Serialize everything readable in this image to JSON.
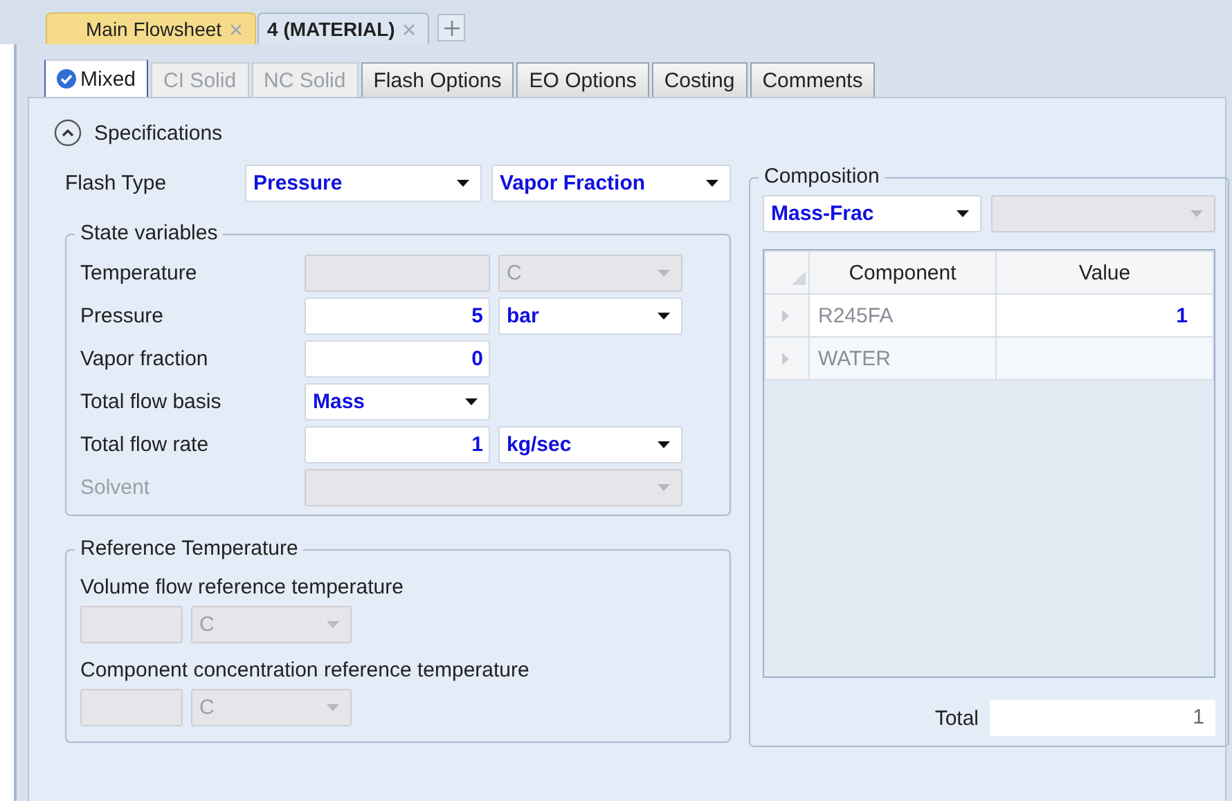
{
  "doc_tabs": [
    {
      "label": "Main Flowsheet",
      "selected": false
    },
    {
      "label": "4 (MATERIAL)",
      "selected": true
    }
  ],
  "tabs": [
    {
      "label": "Mixed",
      "selected": true,
      "disabled": false,
      "complete": true
    },
    {
      "label": "CI Solid",
      "selected": false,
      "disabled": true,
      "complete": false
    },
    {
      "label": "NC Solid",
      "selected": false,
      "disabled": true,
      "complete": false
    },
    {
      "label": "Flash Options",
      "selected": false,
      "disabled": false,
      "complete": false
    },
    {
      "label": "EO Options",
      "selected": false,
      "disabled": false,
      "complete": false
    },
    {
      "label": "Costing",
      "selected": false,
      "disabled": false,
      "complete": false
    },
    {
      "label": "Comments",
      "selected": false,
      "disabled": false,
      "complete": false
    }
  ],
  "section": {
    "title": "Specifications",
    "expanded": true
  },
  "flash_type": {
    "label": "Flash Type",
    "fields": [
      {
        "value": "Pressure"
      },
      {
        "value": "Vapor Fraction"
      }
    ]
  },
  "state_variables": {
    "title": "State variables",
    "rows": [
      {
        "label": "Temperature",
        "disabled": false,
        "controls": [
          {
            "kind": "input",
            "disabled": true
          },
          {
            "kind": "select",
            "value": "C",
            "disabled": true
          }
        ]
      },
      {
        "label": "Pressure",
        "disabled": false,
        "controls": [
          {
            "kind": "input",
            "value": "5",
            "disabled": false
          },
          {
            "kind": "select",
            "value": "bar",
            "disabled": false
          }
        ]
      },
      {
        "label": "Vapor fraction",
        "disabled": false,
        "controls": [
          {
            "kind": "input",
            "value": "0",
            "disabled": false
          }
        ]
      },
      {
        "label": "Total flow basis",
        "disabled": false,
        "controls": [
          {
            "kind": "select",
            "value": "Mass",
            "disabled": false
          }
        ]
      },
      {
        "label": "Total flow rate",
        "disabled": false,
        "controls": [
          {
            "kind": "input",
            "value": "1",
            "disabled": false
          },
          {
            "kind": "select",
            "value": "kg/sec",
            "disabled": false
          }
        ]
      },
      {
        "label": "Solvent",
        "disabled": true,
        "controls": [
          {
            "kind": "wide-select",
            "disabled": true
          }
        ]
      }
    ]
  },
  "reference_temperature": {
    "title": "Reference Temperature",
    "items": [
      {
        "label": "Volume flow reference temperature",
        "unit": "C",
        "disabled": true
      },
      {
        "label": "Component concentration reference temperature",
        "unit": "C",
        "disabled": true
      }
    ]
  },
  "composition": {
    "title": "Composition",
    "basis": {
      "value": "Mass-Frac",
      "disabled": false
    },
    "second_select": {
      "disabled": true
    },
    "table": {
      "columns": [
        "Component",
        "Value"
      ],
      "rows": [
        {
          "component": "R245FA",
          "value": "1"
        },
        {
          "component": "WATER"
        }
      ]
    },
    "total": {
      "label": "Total",
      "value": "1"
    }
  }
}
